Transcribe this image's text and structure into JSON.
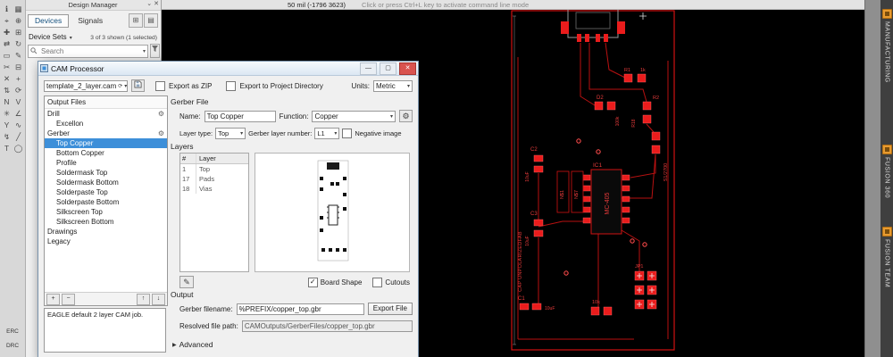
{
  "colors": {
    "accent": "#3d8fd9",
    "pcb_red": "#e01313",
    "tab_orange": "#e89b30",
    "canvas": "#000000",
    "selection_text": "#ffffff"
  },
  "left_toolbar": {
    "erc_label": "ERC",
    "drc_label": "DRC",
    "icons": [
      {
        "name": "info-icon",
        "glyph": "ℹ"
      },
      {
        "name": "layer-settings-icon",
        "glyph": "▦"
      },
      {
        "name": "show-icon",
        "glyph": "⌖"
      },
      {
        "name": "mark-icon",
        "glyph": "⊕"
      },
      {
        "name": "move-icon",
        "glyph": "✚"
      },
      {
        "name": "copy-icon",
        "glyph": "⊞"
      },
      {
        "name": "mirror-icon",
        "glyph": "⇄"
      },
      {
        "name": "rotate-icon",
        "glyph": "↻"
      },
      {
        "name": "group-icon",
        "glyph": "▭"
      },
      {
        "name": "change-icon",
        "glyph": "✎"
      },
      {
        "name": "cut-icon",
        "glyph": "✂"
      },
      {
        "name": "paste-icon",
        "glyph": "⊟"
      },
      {
        "name": "delete-icon",
        "glyph": "✕"
      },
      {
        "name": "add-part-icon",
        "glyph": "+"
      },
      {
        "name": "pinswap-icon",
        "glyph": "⇅"
      },
      {
        "name": "replace-icon",
        "glyph": "⟳"
      },
      {
        "name": "name-icon",
        "glyph": "N"
      },
      {
        "name": "value-icon",
        "glyph": "V"
      },
      {
        "name": "smash-icon",
        "glyph": "✳"
      },
      {
        "name": "miter-icon",
        "glyph": "∠"
      },
      {
        "name": "split-icon",
        "glyph": "Y"
      },
      {
        "name": "route-icon",
        "glyph": "∿"
      },
      {
        "name": "ripup-icon",
        "glyph": "↯"
      },
      {
        "name": "wire-icon",
        "glyph": "╱"
      },
      {
        "name": "text-icon",
        "glyph": "T"
      },
      {
        "name": "circle-icon",
        "glyph": "◯"
      }
    ]
  },
  "design_manager": {
    "title": "Design Manager",
    "pin_icon": "⌄",
    "close_icon": "✕",
    "tabs": [
      {
        "label": "Devices"
      },
      {
        "label": "Signals"
      }
    ],
    "grid_icon": "⊞",
    "list_icon": "▤",
    "device_sets_label": "Device Sets",
    "caret_icon": "▾",
    "shown_summary": "3 of 3 shown (1 selected)",
    "search_placeholder": "Search"
  },
  "top_statusbar": {
    "coords": "50 mil (-1796 3623)",
    "hint": "Click or press Ctrl+L key to activate command line mode"
  },
  "cam_dialog": {
    "title": "CAM Processor",
    "controls": {
      "minimize": "—",
      "maximize": "▢",
      "close": "✕"
    },
    "preset_value": "template_2_layer.cam",
    "icons": {
      "refresh": "⟳",
      "gear": "⚙",
      "caret": "▾",
      "pencil": "✎",
      "add": "+",
      "remove": "−",
      "up": "↑",
      "down": "↓",
      "advanced_arrow": "▶"
    },
    "export_zip_label": "Export as ZIP",
    "export_project_label": "Export to Project Directory",
    "units_label": "Units:",
    "units_value": "Metric",
    "output_files_header": "Output Files",
    "tree": [
      {
        "label": "Drill"
      },
      {
        "label": "Excellon"
      },
      {
        "label": "Gerber"
      },
      {
        "label": "Top Copper"
      },
      {
        "label": "Bottom Copper"
      },
      {
        "label": "Profile"
      },
      {
        "label": "Soldermask Top"
      },
      {
        "label": "Soldermask Bottom"
      },
      {
        "label": "Solderpaste Top"
      },
      {
        "label": "Solderpaste Bottom"
      },
      {
        "label": "Silkscreen Top"
      },
      {
        "label": "Silkscreen Bottom"
      },
      {
        "label": "Drawings"
      },
      {
        "label": "Legacy"
      }
    ],
    "job_description": "EAGLE default 2 layer CAM job.",
    "gerber_file_header": "Gerber File",
    "name_label": "Name:",
    "name_value": "Top Copper",
    "function_label": "Function:",
    "function_value": "Copper",
    "layer_type_label": "Layer type:",
    "layer_type_value": "Top",
    "gerber_layer_label": "Gerber layer number:",
    "gerber_layer_value": "L1",
    "negative_image_label": "Negative image",
    "layers_header": "Layers",
    "layers_table": {
      "columns": [
        "#",
        "Layer"
      ],
      "rows": [
        {
          "num": "1",
          "name": "Top"
        },
        {
          "num": "17",
          "name": "Pads"
        },
        {
          "num": "18",
          "name": "Vias"
        }
      ]
    },
    "board_shape_label": "Board Shape",
    "cutouts_label": "Cutouts",
    "output_header": "Output",
    "gerber_filename_label": "Gerber filename:",
    "gerber_filename_value": "%PREFIX/copper_top.gbr",
    "export_file_button": "Export File",
    "resolved_path_label": "Resolved file path:",
    "resolved_path_value": "CAMOutputs/GerberFiles/copper_top.gbr",
    "advanced_label": "Advanced"
  },
  "side_panel": {
    "tabs": [
      {
        "label": "MANUFACTURING"
      },
      {
        "label": "FUSION 360"
      },
      {
        "label": "FUSION TEAM"
      }
    ]
  },
  "pcb": {
    "labels": [
      "IC1",
      "MC-405",
      "R1",
      "1k",
      "D2",
      "R2",
      "R18",
      "100k",
      "S1/2700",
      "C2",
      "10uF",
      "N$1",
      "N$7",
      "C3",
      "10uF",
      "C1",
      "10uF",
      "10k",
      "JP1",
      "CAP UNPOLARIZEDFAB"
    ]
  }
}
